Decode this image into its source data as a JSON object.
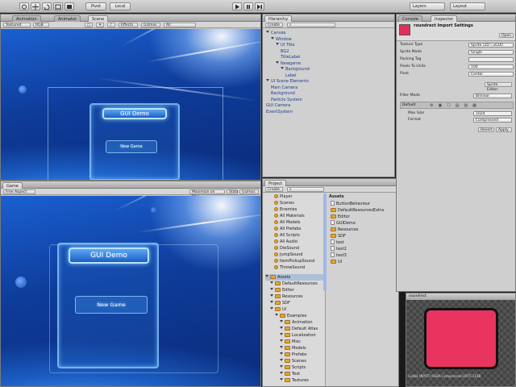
{
  "toolbar": {
    "pivot": "Pivot",
    "local": "Local",
    "layers": "Layers",
    "layout": "Layout"
  },
  "scene_panel": {
    "tabs": [
      "Animation",
      "Animator",
      "Scene"
    ],
    "shaded": "Textured",
    "mode": "RGB",
    "effects": "Effects",
    "gizmos": "Gizmos",
    "search": "All"
  },
  "game_panel": {
    "tab": "Game",
    "aspect": "Free Aspect",
    "maximize": "Maximize on Play",
    "stats": "Stats",
    "gizmos": "Gizmos"
  },
  "game_ui": {
    "title_button": "GUI Demo",
    "new_game_button": "New Game"
  },
  "hierarchy": {
    "tab": "Hierarchy",
    "create": "Create",
    "items": [
      {
        "label": "Canvas",
        "indent": 0,
        "arrow": true
      },
      {
        "label": "Window",
        "indent": 1,
        "arrow": true
      },
      {
        "label": "UI Title",
        "indent": 2,
        "arrow": true
      },
      {
        "label": "BG2",
        "indent": 3,
        "arrow": false
      },
      {
        "label": "TitleLabel",
        "indent": 3,
        "arrow": false
      },
      {
        "label": "Newgame",
        "indent": 2,
        "arrow": true
      },
      {
        "label": "Background",
        "indent": 3,
        "arrow": true
      },
      {
        "label": "Label",
        "indent": 4,
        "arrow": false
      },
      {
        "label": "UI Scene Elements",
        "indent": 0,
        "arrow": true
      },
      {
        "label": "Main Camera",
        "indent": 1,
        "arrow": false
      },
      {
        "label": "Background",
        "indent": 1,
        "arrow": false
      },
      {
        "label": "Particle System",
        "indent": 1,
        "arrow": false
      },
      {
        "label": "GUI Camera",
        "indent": 0,
        "arrow": false
      },
      {
        "label": "EventSystem",
        "indent": 0,
        "arrow": false
      }
    ]
  },
  "project": {
    "tab": "Project",
    "create": "Create",
    "favorites": [
      "Player",
      "Scenes",
      "Enemies",
      "All Materials",
      "All Models",
      "All Prefabs",
      "All Scripts",
      "All Audio",
      "DieSound",
      "JumpSound",
      "ItemPickupSound",
      "ThrowSound"
    ],
    "tree": [
      {
        "label": "Assets",
        "indent": 0
      },
      {
        "label": "DefaultResources",
        "indent": 1
      },
      {
        "label": "Editor",
        "indent": 1
      },
      {
        "label": "Resources",
        "indent": 1
      },
      {
        "label": "SDF",
        "indent": 1
      },
      {
        "label": "UI",
        "indent": 1
      },
      {
        "label": "Examples",
        "indent": 2
      },
      {
        "label": "Animation",
        "indent": 3
      },
      {
        "label": "Default Atlas",
        "indent": 3
      },
      {
        "label": "Localization",
        "indent": 3
      },
      {
        "label": "Misc",
        "indent": 3
      },
      {
        "label": "Models",
        "indent": 3
      },
      {
        "label": "Prefabs",
        "indent": 3
      },
      {
        "label": "Scenes",
        "indent": 3
      },
      {
        "label": "Scripts",
        "indent": 3
      },
      {
        "label": "Text",
        "indent": 3
      },
      {
        "label": "Textures",
        "indent": 3
      }
    ],
    "assets_header": "Assets",
    "assets": [
      {
        "label": "ButtonBehaviour",
        "kind": "file"
      },
      {
        "label": "DefaultResourcesExtra",
        "kind": "folder"
      },
      {
        "label": "Editor",
        "kind": "folder"
      },
      {
        "label": "GUIDemo",
        "kind": "file"
      },
      {
        "label": "Resources",
        "kind": "folder"
      },
      {
        "label": "SDF",
        "kind": "folder"
      },
      {
        "label": "test",
        "kind": "file"
      },
      {
        "label": "test2",
        "kind": "file"
      },
      {
        "label": "test3",
        "kind": "file"
      },
      {
        "label": "UI",
        "kind": "folder"
      }
    ]
  },
  "inspector": {
    "tabs": [
      "Console",
      "Inspector"
    ],
    "title": "roundrect Import Settings",
    "open": "Open",
    "rows": [
      {
        "label": "Texture Type",
        "value": "Sprite (2D \\ uGUI)"
      },
      {
        "label": "Sprite Mode",
        "value": "Single"
      },
      {
        "label": "Packing Tag",
        "value": ""
      },
      {
        "label": "Pixels To Units",
        "value": "100"
      },
      {
        "label": "Pivot",
        "value": "Center"
      }
    ],
    "sprite_editor": "Sprite Editor",
    "filter_mode": {
      "label": "Filter Mode",
      "value": "Bilinear"
    },
    "platform": "Default",
    "max_size": {
      "label": "Max Size",
      "value": "1024"
    },
    "format": {
      "label": "Format",
      "value": "Compressed"
    },
    "revert": "Revert",
    "apply": "Apply",
    "swatch_color": "#e0305a"
  },
  "preview": {
    "title": "roundrect",
    "info": "1x4b4 (NPOT)  RGBA Compressed DXT5  21KB",
    "fill_color": "#e8345f"
  }
}
